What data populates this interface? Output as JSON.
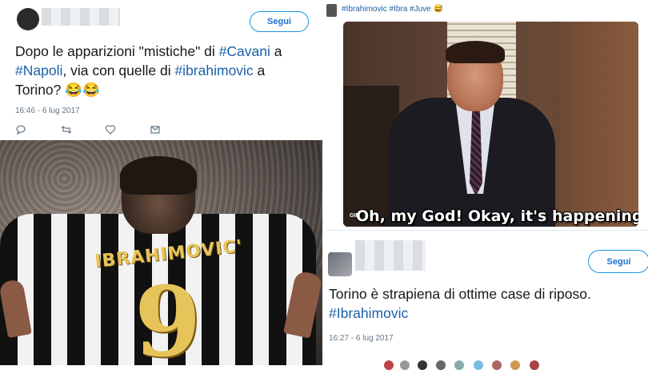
{
  "left_tweet": {
    "follow_label": "Segui",
    "text_parts": [
      "Dopo le apparizioni \"mistiche\" di ",
      "#Cavani",
      " a",
      "#Napoli",
      ", via con quelle di ",
      "#ibrahimovic",
      " a",
      "Torino? ",
      "😂😂"
    ],
    "timestamp": "16:46 - 6 lug 2017",
    "photo": {
      "shirt_name": "IBRAHIMOVIC'",
      "shirt_number": "9"
    },
    "actions": [
      "reply-icon",
      "retweet-icon",
      "like-icon",
      "message-icon"
    ]
  },
  "right_tweet_top": {
    "hashtags": [
      "#Ibrahimovic",
      "#Ibra",
      "#Juve"
    ],
    "emoji": "😅",
    "gif_caption": "Oh, my God! Okay, it's happening!",
    "gif_badge": "GIF"
  },
  "right_tweet_bottom": {
    "follow_label": "Segui",
    "text": "Torino è strapiena di ottime case di riposo.",
    "hashtag": "#Ibrahimovic",
    "timestamp": "16:27 - 6 lug 2017"
  },
  "colors": {
    "link": "#1b5fa8",
    "follow_border": "#1b95e0",
    "meta": "#657786"
  }
}
